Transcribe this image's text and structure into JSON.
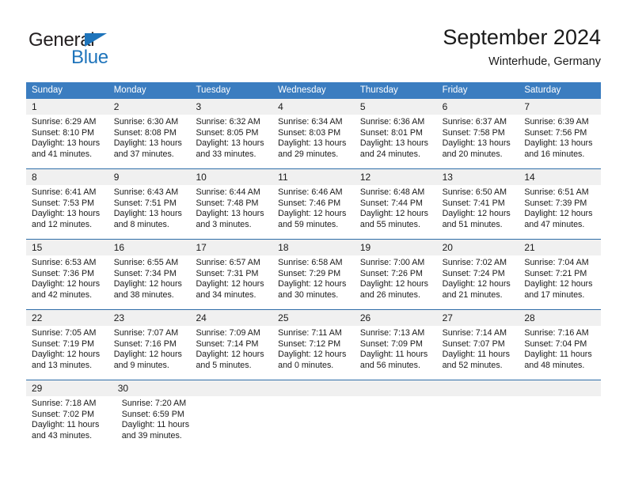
{
  "brand": {
    "name_part1": "General",
    "name_part2": "Blue",
    "triangle_icon": "flag-triangle-icon",
    "accent_color": "#1e74bb"
  },
  "header": {
    "title": "September 2024",
    "subtitle": "Winterhude, Germany"
  },
  "calendar": {
    "header_bg": "#3b7dc0",
    "daynum_bg": "#f0f0f0",
    "separator_color": "#2e6da8",
    "day_names": [
      "Sunday",
      "Monday",
      "Tuesday",
      "Wednesday",
      "Thursday",
      "Friday",
      "Saturday"
    ],
    "weeks": [
      {
        "days": [
          {
            "num": "1",
            "lines": [
              "Sunrise: 6:29 AM",
              "Sunset: 8:10 PM",
              "Daylight: 13 hours",
              "and 41 minutes."
            ]
          },
          {
            "num": "2",
            "lines": [
              "Sunrise: 6:30 AM",
              "Sunset: 8:08 PM",
              "Daylight: 13 hours",
              "and 37 minutes."
            ]
          },
          {
            "num": "3",
            "lines": [
              "Sunrise: 6:32 AM",
              "Sunset: 8:05 PM",
              "Daylight: 13 hours",
              "and 33 minutes."
            ]
          },
          {
            "num": "4",
            "lines": [
              "Sunrise: 6:34 AM",
              "Sunset: 8:03 PM",
              "Daylight: 13 hours",
              "and 29 minutes."
            ]
          },
          {
            "num": "5",
            "lines": [
              "Sunrise: 6:36 AM",
              "Sunset: 8:01 PM",
              "Daylight: 13 hours",
              "and 24 minutes."
            ]
          },
          {
            "num": "6",
            "lines": [
              "Sunrise: 6:37 AM",
              "Sunset: 7:58 PM",
              "Daylight: 13 hours",
              "and 20 minutes."
            ]
          },
          {
            "num": "7",
            "lines": [
              "Sunrise: 6:39 AM",
              "Sunset: 7:56 PM",
              "Daylight: 13 hours",
              "and 16 minutes."
            ]
          }
        ]
      },
      {
        "days": [
          {
            "num": "8",
            "lines": [
              "Sunrise: 6:41 AM",
              "Sunset: 7:53 PM",
              "Daylight: 13 hours",
              "and 12 minutes."
            ]
          },
          {
            "num": "9",
            "lines": [
              "Sunrise: 6:43 AM",
              "Sunset: 7:51 PM",
              "Daylight: 13 hours",
              "and 8 minutes."
            ]
          },
          {
            "num": "10",
            "lines": [
              "Sunrise: 6:44 AM",
              "Sunset: 7:48 PM",
              "Daylight: 13 hours",
              "and 3 minutes."
            ]
          },
          {
            "num": "11",
            "lines": [
              "Sunrise: 6:46 AM",
              "Sunset: 7:46 PM",
              "Daylight: 12 hours",
              "and 59 minutes."
            ]
          },
          {
            "num": "12",
            "lines": [
              "Sunrise: 6:48 AM",
              "Sunset: 7:44 PM",
              "Daylight: 12 hours",
              "and 55 minutes."
            ]
          },
          {
            "num": "13",
            "lines": [
              "Sunrise: 6:50 AM",
              "Sunset: 7:41 PM",
              "Daylight: 12 hours",
              "and 51 minutes."
            ]
          },
          {
            "num": "14",
            "lines": [
              "Sunrise: 6:51 AM",
              "Sunset: 7:39 PM",
              "Daylight: 12 hours",
              "and 47 minutes."
            ]
          }
        ]
      },
      {
        "days": [
          {
            "num": "15",
            "lines": [
              "Sunrise: 6:53 AM",
              "Sunset: 7:36 PM",
              "Daylight: 12 hours",
              "and 42 minutes."
            ]
          },
          {
            "num": "16",
            "lines": [
              "Sunrise: 6:55 AM",
              "Sunset: 7:34 PM",
              "Daylight: 12 hours",
              "and 38 minutes."
            ]
          },
          {
            "num": "17",
            "lines": [
              "Sunrise: 6:57 AM",
              "Sunset: 7:31 PM",
              "Daylight: 12 hours",
              "and 34 minutes."
            ]
          },
          {
            "num": "18",
            "lines": [
              "Sunrise: 6:58 AM",
              "Sunset: 7:29 PM",
              "Daylight: 12 hours",
              "and 30 minutes."
            ]
          },
          {
            "num": "19",
            "lines": [
              "Sunrise: 7:00 AM",
              "Sunset: 7:26 PM",
              "Daylight: 12 hours",
              "and 26 minutes."
            ]
          },
          {
            "num": "20",
            "lines": [
              "Sunrise: 7:02 AM",
              "Sunset: 7:24 PM",
              "Daylight: 12 hours",
              "and 21 minutes."
            ]
          },
          {
            "num": "21",
            "lines": [
              "Sunrise: 7:04 AM",
              "Sunset: 7:21 PM",
              "Daylight: 12 hours",
              "and 17 minutes."
            ]
          }
        ]
      },
      {
        "days": [
          {
            "num": "22",
            "lines": [
              "Sunrise: 7:05 AM",
              "Sunset: 7:19 PM",
              "Daylight: 12 hours",
              "and 13 minutes."
            ]
          },
          {
            "num": "23",
            "lines": [
              "Sunrise: 7:07 AM",
              "Sunset: 7:16 PM",
              "Daylight: 12 hours",
              "and 9 minutes."
            ]
          },
          {
            "num": "24",
            "lines": [
              "Sunrise: 7:09 AM",
              "Sunset: 7:14 PM",
              "Daylight: 12 hours",
              "and 5 minutes."
            ]
          },
          {
            "num": "25",
            "lines": [
              "Sunrise: 7:11 AM",
              "Sunset: 7:12 PM",
              "Daylight: 12 hours",
              "and 0 minutes."
            ]
          },
          {
            "num": "26",
            "lines": [
              "Sunrise: 7:13 AM",
              "Sunset: 7:09 PM",
              "Daylight: 11 hours",
              "and 56 minutes."
            ]
          },
          {
            "num": "27",
            "lines": [
              "Sunrise: 7:14 AM",
              "Sunset: 7:07 PM",
              "Daylight: 11 hours",
              "and 52 minutes."
            ]
          },
          {
            "num": "28",
            "lines": [
              "Sunrise: 7:16 AM",
              "Sunset: 7:04 PM",
              "Daylight: 11 hours",
              "and 48 minutes."
            ]
          }
        ]
      },
      {
        "days": [
          {
            "num": "29",
            "lines": [
              "Sunrise: 7:18 AM",
              "Sunset: 7:02 PM",
              "Daylight: 11 hours",
              "and 43 minutes."
            ]
          },
          {
            "num": "30",
            "lines": [
              "Sunrise: 7:20 AM",
              "Sunset: 6:59 PM",
              "Daylight: 11 hours",
              "and 39 minutes."
            ]
          }
        ]
      }
    ]
  }
}
